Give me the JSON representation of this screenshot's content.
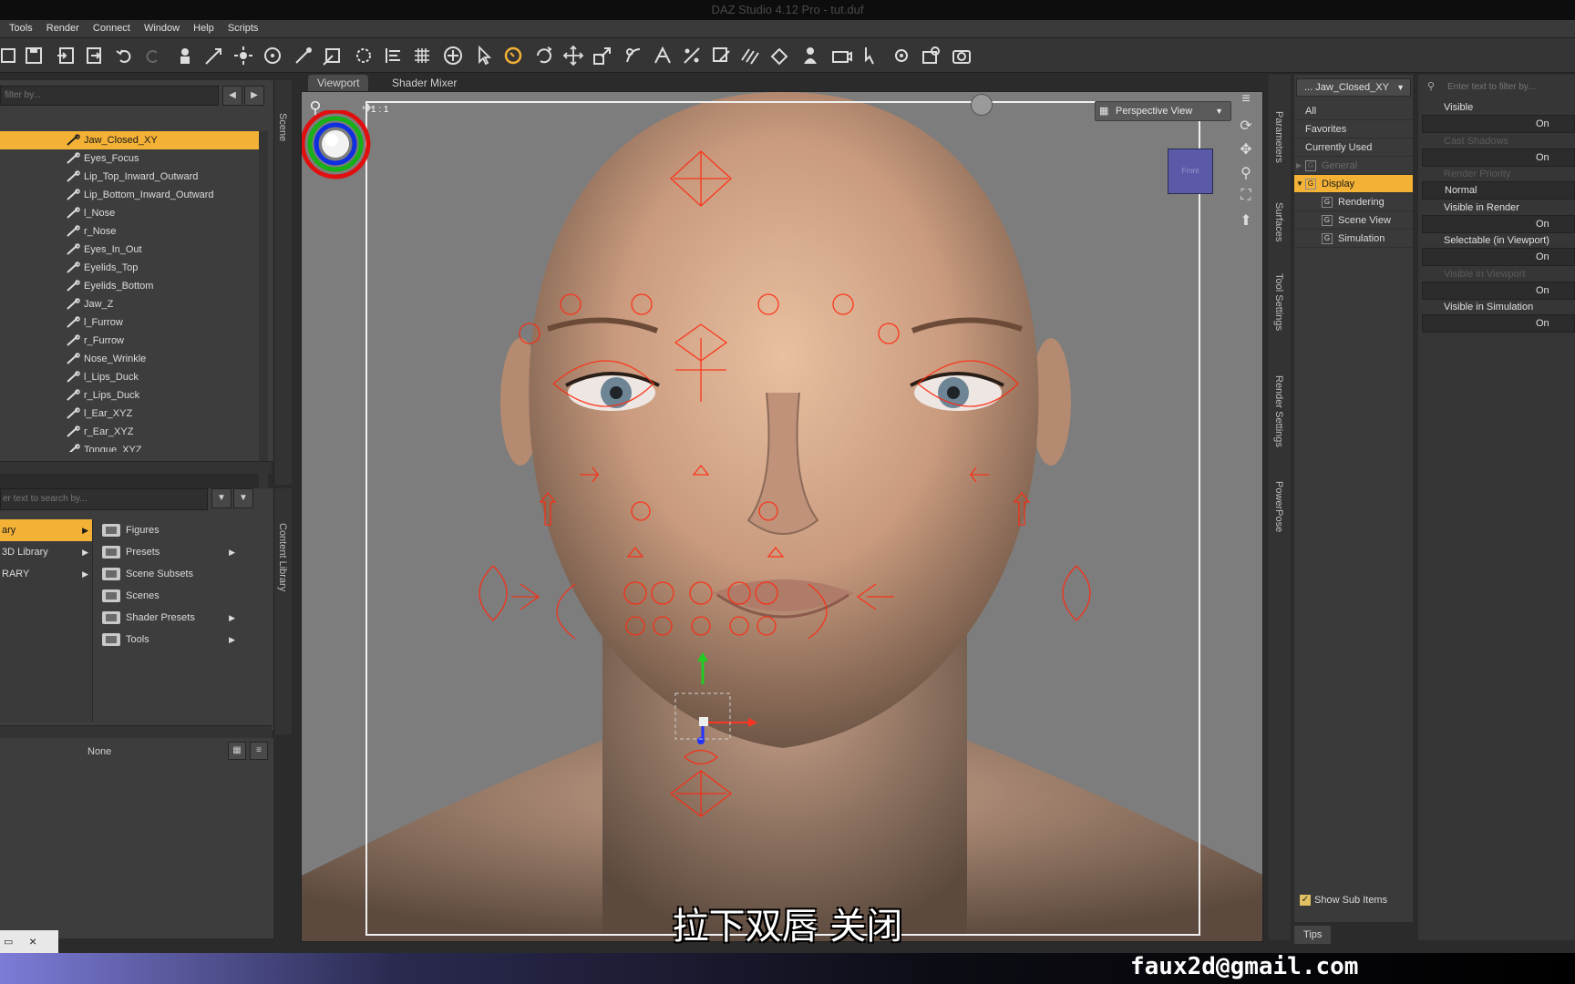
{
  "window": {
    "title": "DAZ Studio 4.12 Pro - tut.duf"
  },
  "menu": [
    "Tools",
    "Render",
    "Connect",
    "Window",
    "Help",
    "Scripts"
  ],
  "scene": {
    "filter_placeholder": "filter by...",
    "tab_label": "Scene",
    "nodes": [
      "Jaw_Closed_XY",
      "Eyes_Focus",
      "Lip_Top_Inward_Outward",
      "Lip_Bottom_Inward_Outward",
      "l_Nose",
      "r_Nose",
      "Eyes_In_Out",
      "Eyelids_Top",
      "Eyelids_Bottom",
      "Jaw_Z",
      "l_Furrow",
      "r_Furrow",
      "Nose_Wrinkle",
      "l_Lips_Duck",
      "r_Lips_Duck",
      "l_Ear_XYZ",
      "r_Ear_XYZ",
      "Tongue_XYZ"
    ],
    "selected": "Jaw_Closed_XY"
  },
  "content_library": {
    "search_placeholder": "er text to search by...",
    "tab_label": "Content Library",
    "libraries": [
      "ary",
      "3D Library",
      "RARY"
    ],
    "folders": [
      {
        "label": "Figures",
        "has_sub": false
      },
      {
        "label": "Presets",
        "has_sub": true
      },
      {
        "label": "Scene Subsets",
        "has_sub": false
      },
      {
        "label": "Scenes",
        "has_sub": false
      },
      {
        "label": "Shader Presets",
        "has_sub": true
      },
      {
        "label": "Tools",
        "has_sub": true
      }
    ],
    "bottom_label": "None"
  },
  "viewport": {
    "tabs": [
      "Viewport",
      "Shader Mixer"
    ],
    "ratio": "1 : 1",
    "view_mode": "Perspective View",
    "cube_label": "Front",
    "subtitle": "拉下双唇 关闭"
  },
  "side_tabs": [
    "Parameters",
    "Surfaces",
    "Tool Settings",
    "Render Settings",
    "PowerPose"
  ],
  "parameters": {
    "node_label": "... Jaw_Closed_XY",
    "filter_placeholder": "Enter text to filter by...",
    "groups": [
      {
        "label": "All",
        "type": "top"
      },
      {
        "label": "Favorites",
        "type": "top"
      },
      {
        "label": "Currently Used",
        "type": "top"
      },
      {
        "label": "General",
        "type": "group-dim"
      },
      {
        "label": "Display",
        "type": "group-sel"
      },
      {
        "label": "Rendering",
        "type": "sub"
      },
      {
        "label": "Scene View",
        "type": "sub"
      },
      {
        "label": "Simulation",
        "type": "sub"
      }
    ],
    "show_sub_items": "Show Sub Items",
    "tips": "Tips",
    "properties": [
      {
        "name": "Visible",
        "value": "On",
        "dim": false
      },
      {
        "name": "Cast Shadows",
        "value": "On",
        "dim": true
      },
      {
        "name": "Render Priority",
        "value": "Normal",
        "dim": true
      },
      {
        "name": "Visible in Render",
        "value": "On",
        "dim": false
      },
      {
        "name": "Selectable (in Viewport)",
        "value": "On",
        "dim": false
      },
      {
        "name": "Visible in Viewport",
        "value": "On",
        "dim": true
      },
      {
        "name": "Visible in Simulation",
        "value": "On",
        "dim": false
      }
    ]
  },
  "watermark": {
    "email": "faux2d@gmail.com"
  },
  "colors": {
    "accent": "#f3b236",
    "panel": "#3d3d3d",
    "viewport_bg": "#7d7d7d"
  }
}
